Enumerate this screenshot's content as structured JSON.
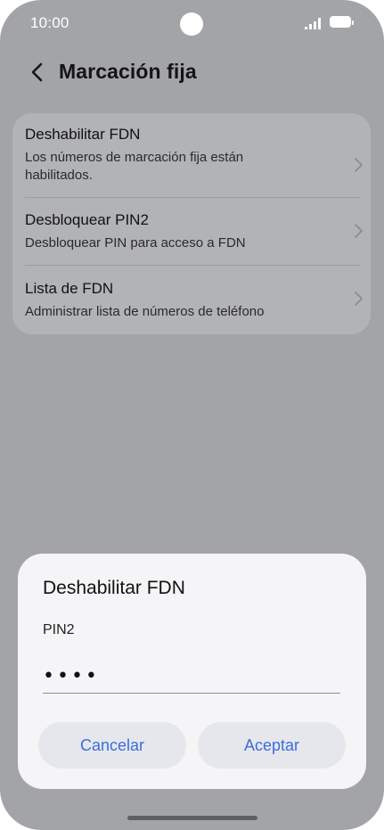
{
  "status": {
    "time": "10:00"
  },
  "header": {
    "title": "Marcación fija"
  },
  "settings": {
    "items": [
      {
        "title": "Deshabilitar FDN",
        "subtitle": "Los números de marcación fija están habilitados."
      },
      {
        "title": "Desbloquear PIN2",
        "subtitle": "Desbloquear PIN para acceso a FDN"
      },
      {
        "title": "Lista de FDN",
        "subtitle": "Administrar lista de números de teléfono"
      }
    ]
  },
  "dialog": {
    "title": "Deshabilitar FDN",
    "field_label": "PIN2",
    "field_value": "••••",
    "cancel_label": "Cancelar",
    "accept_label": "Aceptar"
  },
  "colors": {
    "accent": "#3c6fd8",
    "dim_background": "#a3a4a8",
    "dialog_background": "#f5f5f7"
  },
  "icons": [
    "back-arrow-icon",
    "chevron-right-icon",
    "signal-icon",
    "battery-icon",
    "camera-cutout"
  ]
}
